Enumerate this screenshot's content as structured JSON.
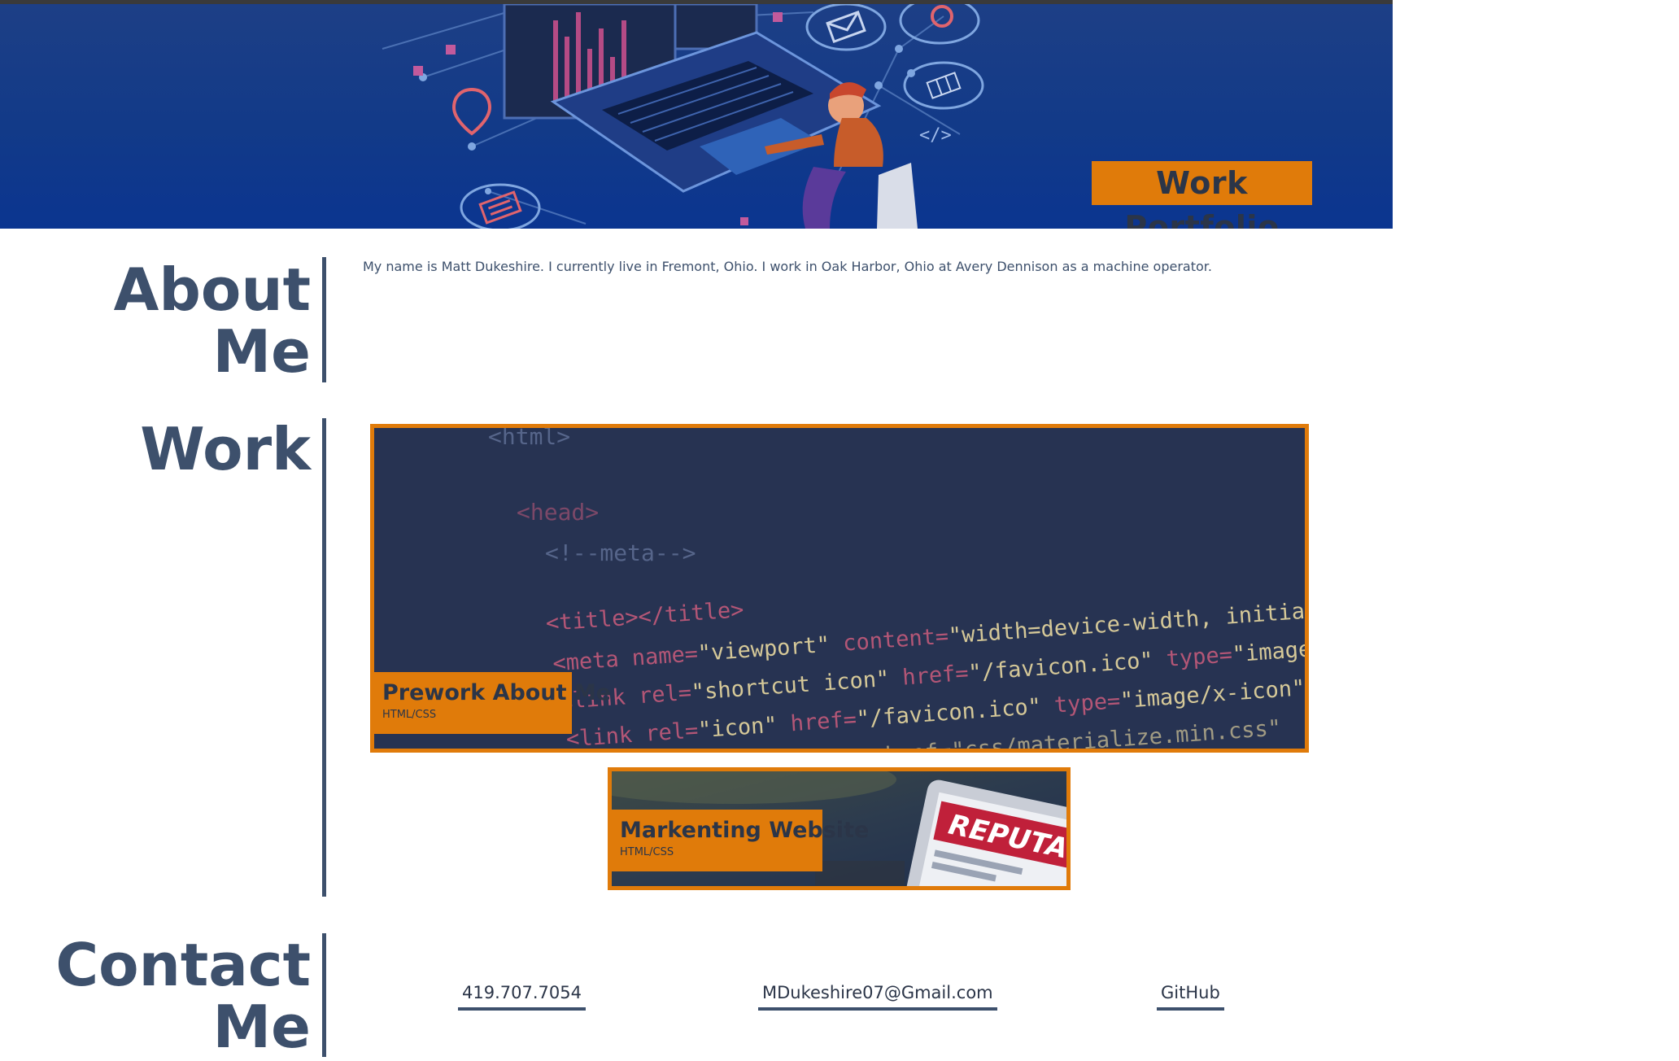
{
  "header": {
    "title": "Work Portfolio"
  },
  "about": {
    "heading_line1": "About",
    "heading_line2": "Me",
    "text": "My name is Matt Dukeshire. I currently live in Fremont, Ohio. I work in Oak Harbor, Ohio at Avery Dennison as a machine operator."
  },
  "work": {
    "heading": "Work",
    "projects": [
      {
        "title": "Prework About Me",
        "tech": "HTML/CSS"
      },
      {
        "title": "Markenting Website",
        "tech": "HTML/CSS"
      }
    ]
  },
  "contact": {
    "heading_line1": "Contact",
    "heading_line2": "Me",
    "phone": "419.707.7054",
    "email": "MDukeshire07@Gmail.com",
    "github": "GitHub"
  },
  "colors": {
    "accent": "#e07b0a",
    "heading": "#3d506c",
    "hero_bg": "#123a88",
    "card_bg": "#283451"
  },
  "icons": [
    "envelope-icon",
    "map-pin-icon",
    "laptop-illustration",
    "person-illustration"
  ]
}
